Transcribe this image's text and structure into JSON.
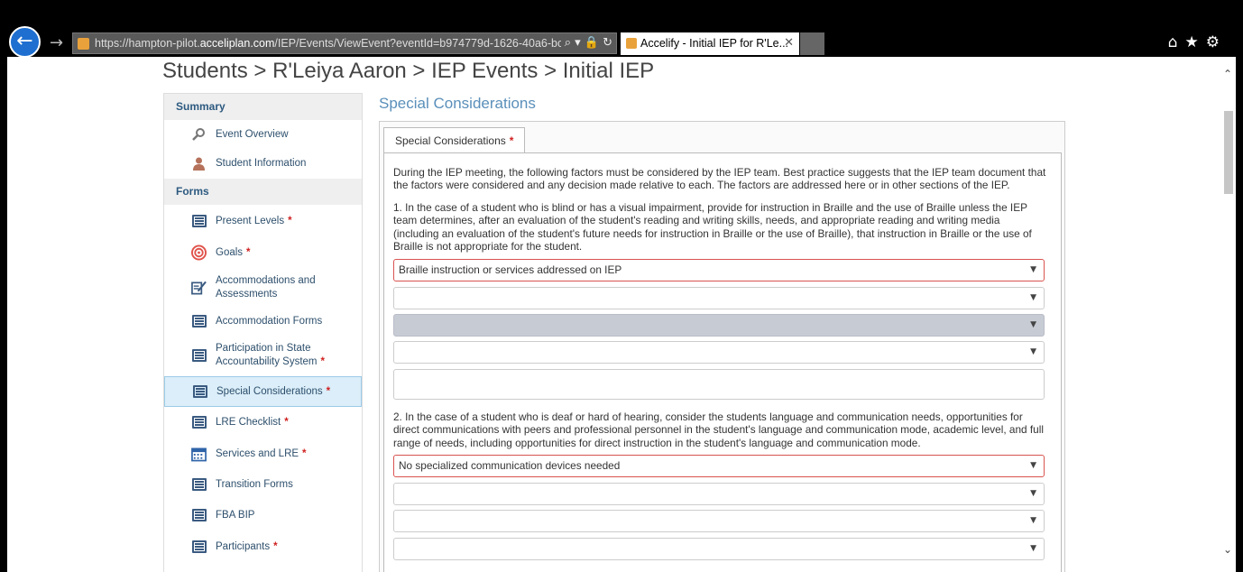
{
  "browser": {
    "url_prefix": "https://hampton-pilot.",
    "url_domain": "acceliplan.com",
    "url_rest": "/IEP/Events/ViewEvent?eventId=b974779d-1626-40a6-bcd",
    "tab_title": "Accelify - Initial IEP for R'Le...",
    "addr_icons": "⌕ ▾ 🔒 ↻",
    "right_icons": "⌂★⚙"
  },
  "breadcrumb": "Students > R'Leiya Aaron > IEP Events > Initial IEP",
  "sidebar": {
    "summary_heading": "Summary",
    "forms_heading": "Forms",
    "summary_items": [
      {
        "label": "Event Overview",
        "icon": "magnifier-icon"
      },
      {
        "label": "Student Information",
        "icon": "person-icon"
      }
    ],
    "form_items": [
      {
        "label": "Present Levels",
        "required": "*",
        "icon": "list-icon"
      },
      {
        "label": "Goals",
        "required": "*",
        "icon": "target-icon"
      },
      {
        "label": "Accommodations and Assessments",
        "required": "",
        "icon": "pencil-doc-icon"
      },
      {
        "label": "Accommodation Forms",
        "required": "",
        "icon": "list-icon"
      },
      {
        "label": "Participation in State Accountability System",
        "required": "*",
        "icon": "list-icon"
      },
      {
        "label": "Special Considerations",
        "required": "*",
        "icon": "list-icon"
      },
      {
        "label": "LRE Checklist",
        "required": "*",
        "icon": "list-icon"
      },
      {
        "label": "Services and LRE",
        "required": "*",
        "icon": "calendar-icon"
      },
      {
        "label": "Transition Forms",
        "required": "",
        "icon": "list-icon"
      },
      {
        "label": "FBA BIP",
        "required": "",
        "icon": "list-icon"
      },
      {
        "label": "Participants",
        "required": "*",
        "icon": "list-icon"
      }
    ]
  },
  "main": {
    "section_title": "Special Considerations",
    "tab_label": "Special Considerations",
    "tab_required": "*",
    "intro": "During the IEP meeting, the following factors must be considered by the IEP team. Best practice suggests that the IEP team document that the factors were considered and any decision made relative to each. The factors are addressed here or in other sections of the IEP.",
    "q1": "1. In the case of a student who is blind or has a visual impairment, provide for instruction in Braille and the use of Braille unless the IEP team determines, after an evaluation of the student's reading and writing skills, needs, and appropriate reading and writing media (including an evaluation of the student's future needs for instruction in Braille or the use of Braille), that instruction in Braille or the use of Braille is not appropriate for the student.",
    "q1_select": "Braille instruction or services addressed on IEP",
    "q2": "2. In the case of a student who is deaf or hard of hearing, consider the students language and communication needs, opportunities for direct communications with peers and professional personnel in the student's language and communication mode, academic level, and full range of needs, including opportunities for direct instruction in the student's language and communication mode.",
    "q2_select": "No specialized communication devices needed"
  },
  "colors": {
    "accent": "#5a8fba",
    "required": "#d02020",
    "error_border": "#d9534f"
  }
}
